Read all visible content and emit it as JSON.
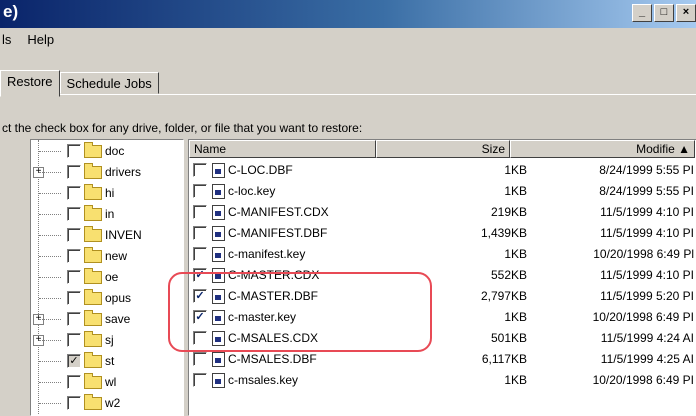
{
  "window": {
    "title": "e)",
    "min_label": "_",
    "max_label": "□",
    "close_label": "×"
  },
  "menu": [
    {
      "label": "ls"
    },
    {
      "label": "Help"
    }
  ],
  "tabs": [
    {
      "label": "Restore"
    },
    {
      "label": "Schedule Jobs"
    }
  ],
  "instructions": "ct the check box for any drive, folder, or file that you want to restore:",
  "tree": {
    "items": [
      {
        "label": "doc",
        "expandable": false,
        "checked": false
      },
      {
        "label": "drivers",
        "expandable": true,
        "checked": false
      },
      {
        "label": "hi",
        "expandable": false,
        "checked": false
      },
      {
        "label": "in",
        "expandable": false,
        "checked": false
      },
      {
        "label": "INVEN",
        "expandable": false,
        "checked": false
      },
      {
        "label": "new",
        "expandable": false,
        "checked": false
      },
      {
        "label": "oe",
        "expandable": false,
        "checked": false
      },
      {
        "label": "opus",
        "expandable": false,
        "checked": false
      },
      {
        "label": "save",
        "expandable": true,
        "checked": false
      },
      {
        "label": "sj",
        "expandable": true,
        "checked": false
      },
      {
        "label": "st",
        "expandable": false,
        "checked": true
      },
      {
        "label": "wl",
        "expandable": false,
        "checked": false
      },
      {
        "label": "w2",
        "expandable": false,
        "checked": false
      }
    ],
    "scroll_up": "▲"
  },
  "list": {
    "columns": {
      "name": "Name",
      "size": "Size",
      "modified": "Modifie ▲"
    },
    "rows": [
      {
        "name": "C-LOC.DBF",
        "size": "1KB",
        "modified": "8/24/1999 5:55 PI",
        "checked": false
      },
      {
        "name": "c-loc.key",
        "size": "1KB",
        "modified": "8/24/1999 5:55 PI",
        "checked": false
      },
      {
        "name": "C-MANIFEST.CDX",
        "size": "219KB",
        "modified": "11/5/1999 4:10 PI",
        "checked": false
      },
      {
        "name": "C-MANIFEST.DBF",
        "size": "1,439KB",
        "modified": "11/5/1999 4:10 PI",
        "checked": false
      },
      {
        "name": "c-manifest.key",
        "size": "1KB",
        "modified": "10/20/1998 6:49 Pl",
        "checked": false
      },
      {
        "name": "C-MASTER.CDX",
        "size": "552KB",
        "modified": "11/5/1999 4:10 PI",
        "checked": true
      },
      {
        "name": "C-MASTER.DBF",
        "size": "2,797KB",
        "modified": "11/5/1999 5:20 PI",
        "checked": true
      },
      {
        "name": "c-master.key",
        "size": "1KB",
        "modified": "10/20/1998 6:49 PI",
        "checked": true
      },
      {
        "name": "C-MSALES.CDX",
        "size": "501KB",
        "modified": "11/5/1999 4:24 AI",
        "checked": false
      },
      {
        "name": "C-MSALES.DBF",
        "size": "6,117KB",
        "modified": "11/5/1999 4:25 AI",
        "checked": false
      },
      {
        "name": "c-msales.key",
        "size": "1KB",
        "modified": "10/20/1998 6:49 PI",
        "checked": false
      }
    ]
  },
  "colors": {
    "highlight": "#e84a55",
    "titlebar_start": "#0a246a",
    "titlebar_end": "#a6caf0"
  }
}
